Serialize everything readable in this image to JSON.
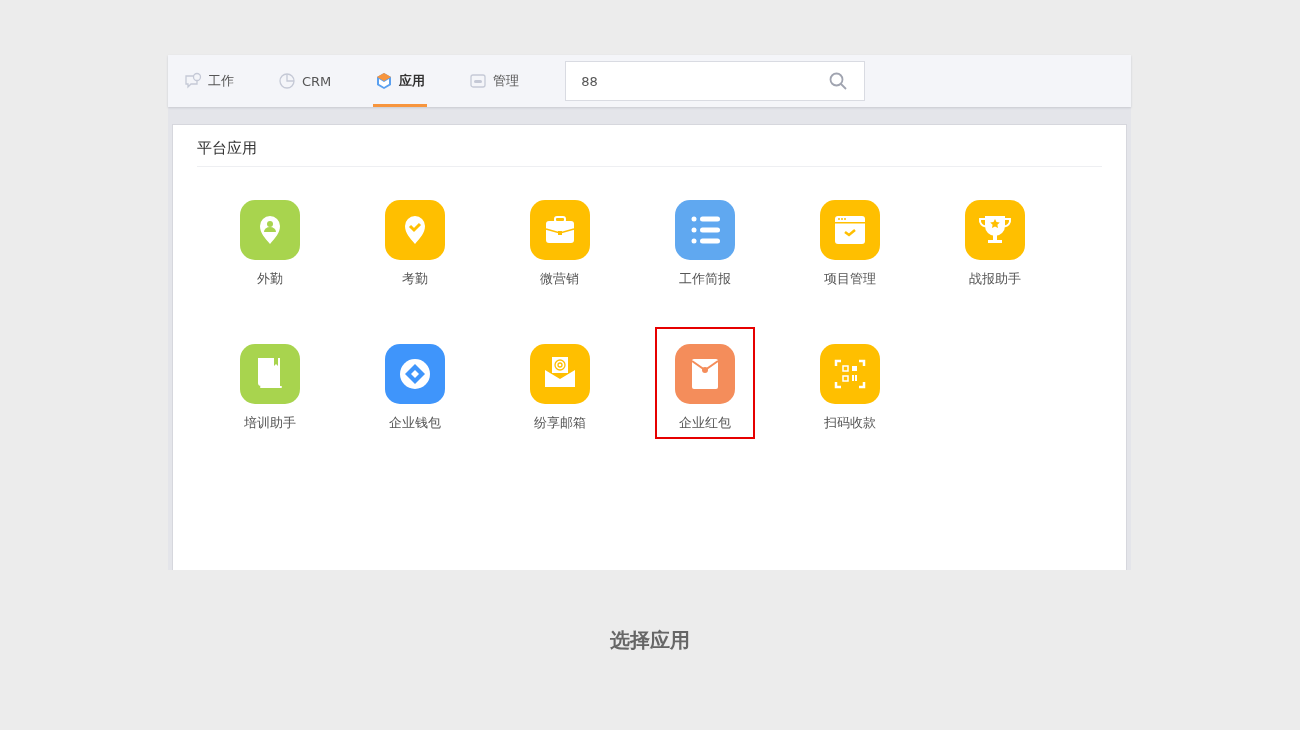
{
  "tabs": [
    {
      "label": "工作",
      "kind": "chat",
      "selected": false
    },
    {
      "label": "CRM",
      "kind": "pie",
      "selected": false
    },
    {
      "label": "应用",
      "kind": "cube",
      "selected": true
    },
    {
      "label": "管理",
      "kind": "card",
      "selected": false
    }
  ],
  "search": {
    "value": "88"
  },
  "section": {
    "title": "平台应用"
  },
  "apps": [
    {
      "label": "外勤",
      "kind": "pin-person",
      "color": "#a8d44e",
      "highlighted": false
    },
    {
      "label": "考勤",
      "kind": "pin-check",
      "color": "#ffbf00",
      "highlighted": false
    },
    {
      "label": "微营销",
      "kind": "briefcase",
      "color": "#ffbf00",
      "highlighted": false
    },
    {
      "label": "工作简报",
      "kind": "list",
      "color": "#60a8f0",
      "highlighted": false
    },
    {
      "label": "项目管理",
      "kind": "window-check",
      "color": "#ffbf00",
      "highlighted": false
    },
    {
      "label": "战报助手",
      "kind": "trophy",
      "color": "#ffbf00",
      "highlighted": false
    },
    {
      "label": "培训助手",
      "kind": "book",
      "color": "#a8d44e",
      "highlighted": false
    },
    {
      "label": "企业钱包",
      "kind": "wallet",
      "color": "#3f95fb",
      "highlighted": false
    },
    {
      "label": "纷享邮箱",
      "kind": "mail",
      "color": "#ffbf00",
      "highlighted": false
    },
    {
      "label": "企业红包",
      "kind": "envelope",
      "color": "#f48d5b",
      "highlighted": true
    },
    {
      "label": "扫码收款",
      "kind": "scan",
      "color": "#ffbf00",
      "highlighted": false
    }
  ],
  "caption": "选择应用"
}
